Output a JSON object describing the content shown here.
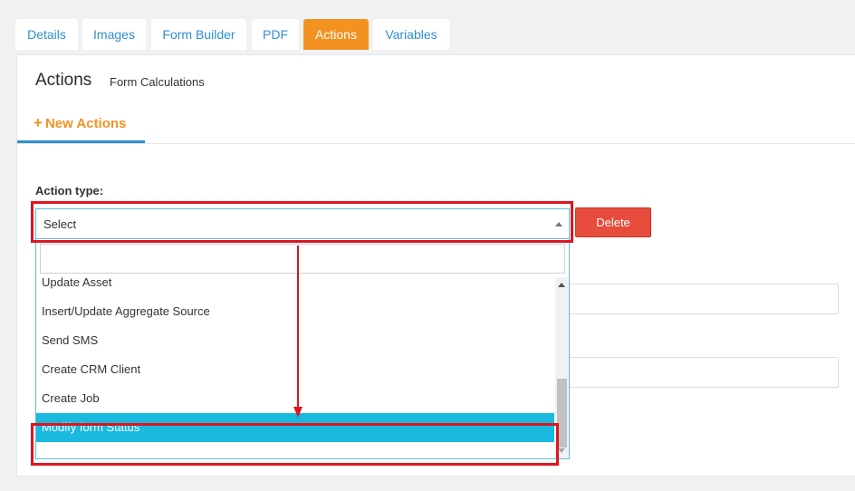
{
  "tabs": [
    {
      "label": "Details",
      "active": false
    },
    {
      "label": "Images",
      "active": false
    },
    {
      "label": "Form Builder",
      "active": false
    },
    {
      "label": "PDF",
      "active": false
    },
    {
      "label": "Actions",
      "active": true
    },
    {
      "label": "Variables",
      "active": false
    }
  ],
  "panel": {
    "title": "Actions",
    "subtitle": "Form Calculations",
    "new_actions_label": "New Actions"
  },
  "action_type": {
    "label": "Action type:",
    "select_value": "Select",
    "search_value": "",
    "options": [
      "Update Asset",
      "Insert/Update Aggregate Source",
      "Send SMS",
      "Create CRM Client",
      "Create Job",
      "Modify form Status"
    ],
    "highlighted": "Modify form Status"
  },
  "delete_label": "Delete",
  "colors": {
    "accent_orange": "#f39221",
    "link_blue": "#2f8fce",
    "highlight_blue": "#1ab9e0",
    "delete_red": "#e74c3c",
    "annotation_red": "#e0141e"
  },
  "icons": {
    "plus": "plus-icon",
    "select_caret": "caret-up-icon",
    "scroll_up": "scroll-up-arrow-icon",
    "scroll_down": "scroll-down-arrow-icon"
  }
}
